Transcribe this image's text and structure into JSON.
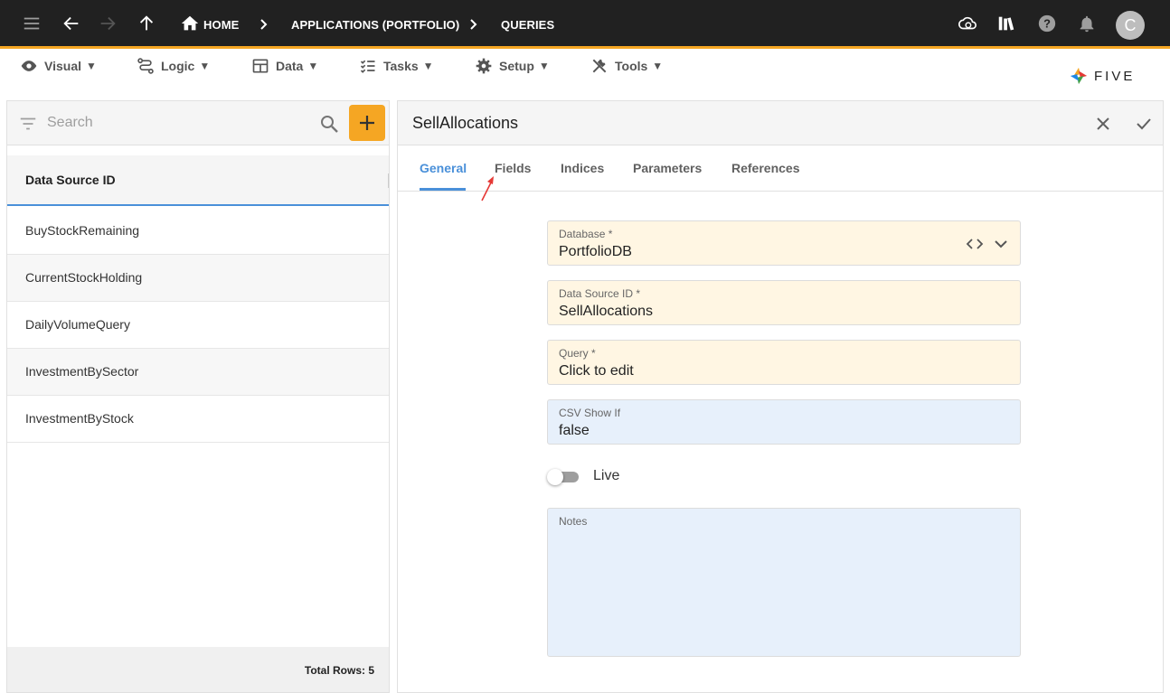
{
  "topbar": {
    "breadcrumbs": [
      "HOME",
      "APPLICATIONS (PORTFOLIO)",
      "QUERIES"
    ],
    "avatar_letter": "C",
    "accent": "#f5a623"
  },
  "menu": {
    "items": [
      {
        "label": "Visual",
        "icon": "eye-icon"
      },
      {
        "label": "Logic",
        "icon": "logic-icon"
      },
      {
        "label": "Data",
        "icon": "table-icon"
      },
      {
        "label": "Tasks",
        "icon": "tasks-icon"
      },
      {
        "label": "Setup",
        "icon": "gear-icon"
      },
      {
        "label": "Tools",
        "icon": "tools-icon"
      }
    ],
    "logo_text": "FIVE"
  },
  "list": {
    "search_placeholder": "Search",
    "column_header": "Data Source ID",
    "rows": [
      "BuyStockRemaining",
      "CurrentStockHolding",
      "DailyVolumeQuery",
      "InvestmentBySector",
      "InvestmentByStock"
    ],
    "total_rows": "Total Rows: 5"
  },
  "form": {
    "title": "SellAllocations",
    "tabs": [
      "General",
      "Fields",
      "Indices",
      "Parameters",
      "References"
    ],
    "active_tab": "General",
    "fields": {
      "database": {
        "label": "Database *",
        "value": "PortfolioDB"
      },
      "data_source_id": {
        "label": "Data Source ID *",
        "value": "SellAllocations"
      },
      "query": {
        "label": "Query *",
        "value": "Click to edit"
      },
      "csv_show_if": {
        "label": "CSV Show If",
        "value": "false"
      },
      "live": {
        "label": "Live"
      },
      "notes": {
        "label": "Notes",
        "value": ""
      }
    }
  }
}
